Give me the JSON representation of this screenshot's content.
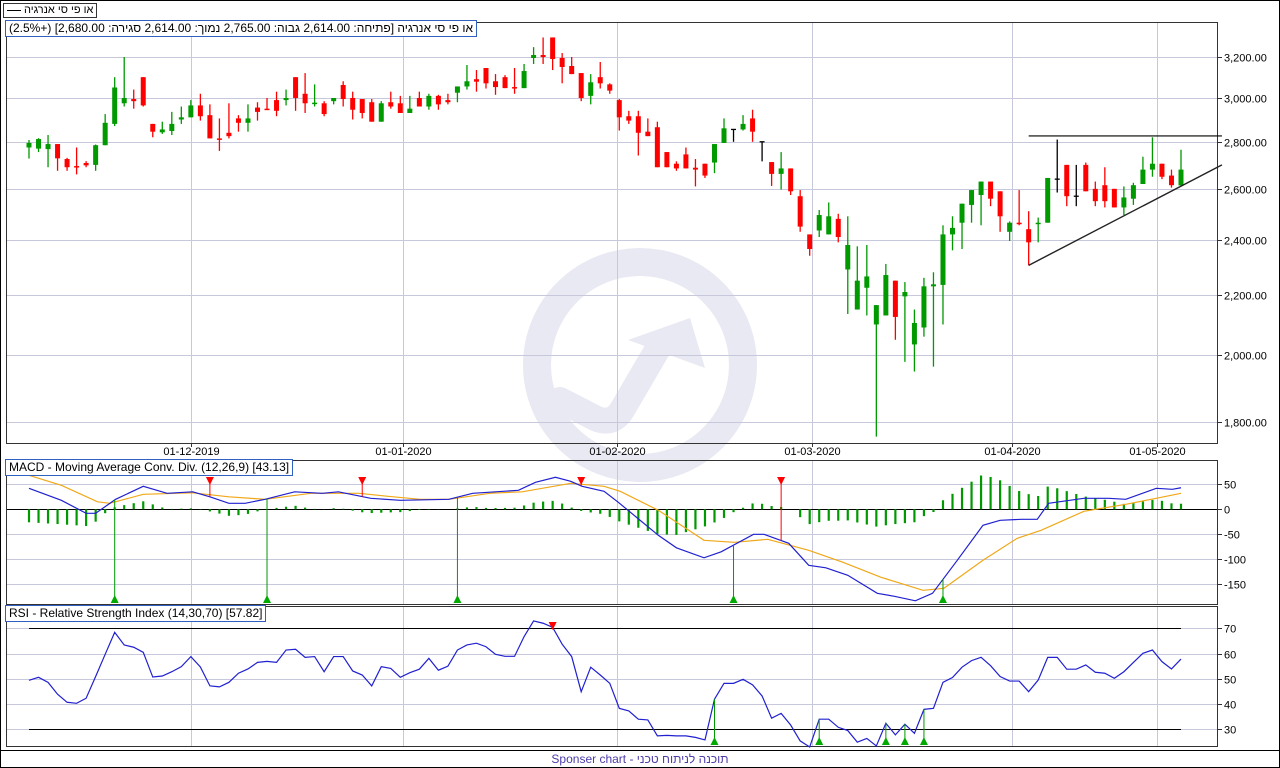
{
  "legend": {
    "symbol_name": "או פי סי אנרגיה"
  },
  "header": {
    "text": "או פי סי אנרגיה [פתיחה: 2,614.00  גבוה: 2,765.00  נמוך: 2,614.00  סגירה: 2,680.00] (+2.5%)"
  },
  "macd_title": "MACD - Moving Average Conv. Div. (12,26,9) [43.13]",
  "rsi_title": "RSI - Relative Strength Index (14,30,70) [57.82]",
  "footer": "Sponser chart - תוכנה לניתוח טכני",
  "colors": {
    "up": "#009900",
    "down": "#ff0000",
    "unchanged": "#000000",
    "macd": "#2020d0",
    "signal": "#f0a818",
    "grid": "#c8c8dc",
    "watermark": "#e9e9f3"
  },
  "chart_data": [
    {
      "type": "candlestick",
      "title": "או פי סי אנרגיה",
      "scale": "log",
      "ylim": [
        1760,
        3300
      ],
      "y_ticks": [
        "3,200.00",
        "3,000.00",
        "2,800.00",
        "2,600.00",
        "2,400.00",
        "2,200.00",
        "2,000.00",
        "1,800.00"
      ],
      "y_tick_values": [
        3200,
        3000,
        2800,
        2600,
        2400,
        2200,
        2000,
        1800
      ],
      "x_ticks": [
        {
          "label": "01-12-2019",
          "index": 17
        },
        {
          "label": "01-01-2020",
          "index": 39.3
        },
        {
          "label": "01-02-2020",
          "index": 61.8
        },
        {
          "label": "01-03-2020",
          "index": 82.2
        },
        {
          "label": "01-04-2020",
          "index": 103.3
        },
        {
          "label": "01-05-2020",
          "index": 118.5
        }
      ],
      "ohlc": [
        [
          2775,
          2808,
          2727,
          2795
        ],
        [
          2770,
          2816,
          2755,
          2812
        ],
        [
          2768,
          2830,
          2690,
          2790
        ],
        [
          2790,
          2790,
          2675,
          2728
        ],
        [
          2725,
          2730,
          2675,
          2690
        ],
        [
          2695,
          2775,
          2660,
          2690
        ],
        [
          2708,
          2716,
          2690,
          2698
        ],
        [
          2700,
          2788,
          2675,
          2785
        ],
        [
          2785,
          2925,
          2785,
          2885
        ],
        [
          2880,
          3100,
          2870,
          3050
        ],
        [
          2975,
          3200,
          2960,
          3000
        ],
        [
          2995,
          3040,
          2950,
          2985
        ],
        [
          3100,
          3100,
          2960,
          2965
        ],
        [
          2880,
          2880,
          2820,
          2845
        ],
        [
          2842,
          2890,
          2835,
          2855
        ],
        [
          2848,
          2935,
          2830,
          2880
        ],
        [
          2900,
          2960,
          2880,
          2910
        ],
        [
          2910,
          2990,
          2910,
          2965
        ],
        [
          2965,
          3020,
          2895,
          2915
        ],
        [
          2920,
          2970,
          2815,
          2815
        ],
        [
          2815,
          2905,
          2760,
          2810
        ],
        [
          2840,
          2975,
          2815,
          2825
        ],
        [
          2905,
          2920,
          2845,
          2885
        ],
        [
          2885,
          2970,
          2845,
          2905
        ],
        [
          2955,
          2980,
          2895,
          2935
        ],
        [
          2950,
          3000,
          2945,
          2945
        ],
        [
          2990,
          3030,
          2915,
          2940
        ],
        [
          2990,
          3040,
          2965,
          3000
        ],
        [
          3100,
          3100,
          2940,
          3000
        ],
        [
          3020,
          3120,
          2930,
          2975
        ],
        [
          2975,
          3065,
          2960,
          2978
        ],
        [
          2975,
          2985,
          2915,
          2925
        ],
        [
          2985,
          3000,
          2970,
          3000
        ],
        [
          3062,
          3080,
          2960,
          2995
        ],
        [
          3000,
          3030,
          2900,
          2945
        ],
        [
          2995,
          2995,
          2905,
          2930
        ],
        [
          2980,
          2995,
          2890,
          2890
        ],
        [
          2890,
          2985,
          2890,
          2975
        ],
        [
          2980,
          3030,
          2950,
          2960
        ],
        [
          2975,
          3010,
          2930,
          2930
        ],
        [
          2930,
          3010,
          2930,
          2950
        ],
        [
          3000,
          3030,
          2960,
          2960
        ],
        [
          2960,
          3020,
          2945,
          3010
        ],
        [
          3010,
          3015,
          2945,
          2970
        ],
        [
          2990,
          3020,
          2970,
          2980
        ],
        [
          3025,
          3055,
          2980,
          3055
        ],
        [
          3055,
          3160,
          3040,
          3080
        ],
        [
          3090,
          3135,
          3030,
          3078
        ],
        [
          3145,
          3145,
          3045,
          3070
        ],
        [
          3080,
          3115,
          3015,
          3052
        ],
        [
          3100,
          3110,
          3047,
          3047
        ],
        [
          3052,
          3145,
          3020,
          3047
        ],
        [
          3047,
          3165,
          3047,
          3130
        ],
        [
          3195,
          3250,
          3165,
          3210
        ],
        [
          3210,
          3300,
          3165,
          3200
        ],
        [
          3300,
          3300,
          3135,
          3190
        ],
        [
          3195,
          3220,
          3070,
          3150
        ],
        [
          3155,
          3200,
          3115,
          3115
        ],
        [
          3120,
          3120,
          2985,
          3000
        ],
        [
          3010,
          3115,
          2970,
          3075
        ],
        [
          3100,
          3175,
          3045,
          3070
        ],
        [
          3065,
          3070,
          3020,
          3035
        ],
        [
          2990,
          2995,
          2850,
          2910
        ],
        [
          2915,
          2940,
          2880,
          2895
        ],
        [
          2915,
          2940,
          2740,
          2840
        ],
        [
          2845,
          2905,
          2825,
          2825
        ],
        [
          2865,
          2890,
          2690,
          2690
        ],
        [
          2755,
          2755,
          2690,
          2690
        ],
        [
          2705,
          2715,
          2675,
          2685
        ],
        [
          2745,
          2775,
          2685,
          2685
        ],
        [
          2688,
          2725,
          2610,
          2680
        ],
        [
          2705,
          2705,
          2645,
          2655
        ],
        [
          2710,
          2790,
          2665,
          2790
        ],
        [
          2795,
          2905,
          2795,
          2860
        ],
        [
          2855,
          2855,
          2800,
          2855
        ],
        [
          2855,
          2920,
          2850,
          2880
        ],
        [
          2905,
          2945,
          2800,
          2845
        ],
        [
          2800,
          2800,
          2715,
          2800
        ],
        [
          2712,
          2712,
          2612,
          2662
        ],
        [
          2662,
          2755,
          2597,
          2685
        ],
        [
          2685,
          2685,
          2575,
          2590
        ],
        [
          2570,
          2595,
          2430,
          2450
        ],
        [
          2420,
          2420,
          2340,
          2365
        ],
        [
          2435,
          2515,
          2410,
          2495
        ],
        [
          2420,
          2545,
          2420,
          2490
        ],
        [
          2480,
          2500,
          2390,
          2410
        ],
        [
          2290,
          2490,
          2135,
          2380
        ],
        [
          2150,
          2375,
          2150,
          2250
        ],
        [
          2225,
          2380,
          2130,
          2265
        ],
        [
          2100,
          2165,
          1760,
          2165
        ],
        [
          2130,
          2310,
          2130,
          2270
        ],
        [
          2250,
          2250,
          2050,
          2125
        ],
        [
          2195,
          2245,
          1980,
          2210
        ],
        [
          2035,
          2150,
          1950,
          2105
        ],
        [
          2090,
          2260,
          2060,
          2230
        ],
        [
          2230,
          2280,
          1965,
          2237
        ],
        [
          2235,
          2455,
          2100,
          2420
        ],
        [
          2420,
          2490,
          2360,
          2445
        ],
        [
          2465,
          2540,
          2365,
          2540
        ],
        [
          2535,
          2595,
          2465,
          2595
        ],
        [
          2575,
          2630,
          2455,
          2630
        ],
        [
          2630,
          2630,
          2530,
          2560
        ],
        [
          2590,
          2590,
          2430,
          2490
        ],
        [
          2430,
          2470,
          2395,
          2465
        ],
        [
          2465,
          2595,
          2455,
          2460
        ],
        [
          2440,
          2510,
          2305,
          2390
        ],
        [
          2460,
          2485,
          2390,
          2465
        ],
        [
          2465,
          2645,
          2465,
          2645
        ],
        [
          2640,
          2810,
          2585,
          2640
        ],
        [
          2700,
          2700,
          2530,
          2570
        ],
        [
          2570,
          2700,
          2530,
          2570
        ],
        [
          2700,
          2710,
          2590,
          2590
        ],
        [
          2600,
          2630,
          2530,
          2550
        ],
        [
          2615,
          2690,
          2525,
          2550
        ],
        [
          2600,
          2600,
          2525,
          2525
        ],
        [
          2525,
          2610,
          2495,
          2565
        ],
        [
          2560,
          2625,
          2535,
          2615
        ],
        [
          2620,
          2735,
          2620,
          2680
        ],
        [
          2680,
          2820,
          2650,
          2705
        ],
        [
          2705,
          2705,
          2640,
          2650
        ],
        [
          2655,
          2680,
          2605,
          2615
        ],
        [
          2614,
          2765,
          2614,
          2680
        ]
      ],
      "drawings": [
        {
          "type": "horizontal-line",
          "from_index": 105,
          "to_index": 125.3,
          "price": 2826
        },
        {
          "type": "trendline",
          "from": [
            105,
            2305
          ],
          "to": [
            125.3,
            2700
          ]
        }
      ]
    },
    {
      "type": "line",
      "title": "MACD - Moving Average Conv. Div. (12,26,9)",
      "ylim": [
        -188,
        94
      ],
      "y_ticks": [
        50,
        0,
        -50,
        -100,
        -150
      ],
      "y_tick_labels": [
        "50",
        "0",
        "-50",
        "-100",
        "-150"
      ],
      "macd": [
        [
          0,
          42
        ],
        [
          3.4,
          18
        ],
        [
          6,
          -8
        ],
        [
          7,
          -8
        ],
        [
          9.1,
          20
        ],
        [
          12,
          46
        ],
        [
          14.5,
          32
        ],
        [
          17.2,
          35
        ],
        [
          19,
          25
        ],
        [
          21,
          12
        ],
        [
          22.7,
          12
        ],
        [
          24.8,
          20
        ],
        [
          27.9,
          35
        ],
        [
          30.8,
          32
        ],
        [
          32.5,
          35
        ],
        [
          35.9,
          22
        ],
        [
          39,
          18
        ],
        [
          44.1,
          20
        ],
        [
          46.6,
          32
        ],
        [
          51.4,
          38
        ],
        [
          53.2,
          54
        ],
        [
          55.3,
          64
        ],
        [
          56.9,
          56
        ],
        [
          58.1,
          46
        ],
        [
          60.4,
          36
        ],
        [
          61.9,
          14
        ],
        [
          66.1,
          -52
        ],
        [
          68,
          -77
        ],
        [
          70.9,
          -97
        ],
        [
          72.7,
          -85
        ],
        [
          76.1,
          -50
        ],
        [
          77.2,
          -50
        ],
        [
          79.8,
          -68
        ],
        [
          81.9,
          -112
        ],
        [
          83.7,
          -117
        ],
        [
          86,
          -132
        ],
        [
          89.1,
          -168
        ],
        [
          90.9,
          -174
        ],
        [
          93.1,
          -183
        ],
        [
          94.9,
          -168
        ],
        [
          97.5,
          -102
        ],
        [
          100.2,
          -32
        ],
        [
          102,
          -22
        ],
        [
          104.2,
          -20
        ],
        [
          105.9,
          -20
        ],
        [
          107.1,
          12
        ],
        [
          110.8,
          22
        ],
        [
          113.4,
          22
        ],
        [
          115.2,
          20
        ],
        [
          118.4,
          42
        ],
        [
          120.1,
          40
        ],
        [
          121,
          43.13
        ]
      ],
      "signal": [
        [
          0,
          68
        ],
        [
          3.4,
          48
        ],
        [
          7.2,
          15
        ],
        [
          8.5,
          12
        ],
        [
          12,
          30
        ],
        [
          17.2,
          33
        ],
        [
          21,
          25
        ],
        [
          24.8,
          20
        ],
        [
          29.6,
          32
        ],
        [
          34.7,
          32
        ],
        [
          37.7,
          26
        ],
        [
          41.1,
          20
        ],
        [
          44.1,
          20
        ],
        [
          48.4,
          32
        ],
        [
          51.8,
          35
        ],
        [
          56.9,
          52
        ],
        [
          60.4,
          46
        ],
        [
          62.1,
          36
        ],
        [
          66.1,
          -2
        ],
        [
          70.9,
          -62
        ],
        [
          74.1,
          -66
        ],
        [
          77.6,
          -60
        ],
        [
          81.9,
          -82
        ],
        [
          85.5,
          -106
        ],
        [
          89.5,
          -136
        ],
        [
          93.9,
          -162
        ],
        [
          96.1,
          -158
        ],
        [
          100.2,
          -102
        ],
        [
          103.8,
          -58
        ],
        [
          106.3,
          -42
        ],
        [
          110.8,
          -4
        ],
        [
          115.2,
          10
        ],
        [
          118.4,
          22
        ],
        [
          121,
          32
        ]
      ],
      "histogram": "macd-minus-signal",
      "sell_signals": [
        19,
        35,
        58,
        79
      ],
      "buy_signals": [
        9,
        25,
        45,
        74,
        96
      ],
      "last_value": 43.13
    },
    {
      "type": "line",
      "title": "RSI - Relative Strength Index (14,30,70)",
      "ylim": [
        22,
        78
      ],
      "levels": [
        30,
        70
      ],
      "y_ticks": [
        70,
        60,
        50,
        40,
        30
      ],
      "y_tick_labels": [
        "70",
        "60",
        "50",
        "40",
        "30"
      ],
      "rsi": [
        49.4,
        50.6,
        48.6,
        43.9,
        40.7,
        40.3,
        42.3,
        50.9,
        59.7,
        68.4,
        63.4,
        62.5,
        60.5,
        50.7,
        51.1,
        52.8,
        54.8,
        58.8,
        54.7,
        47.2,
        46.8,
        48.6,
        52.2,
        53.9,
        56.5,
        56.9,
        56.5,
        61.4,
        61.7,
        58.5,
        58.8,
        52.8,
        58.8,
        58.8,
        53.1,
        51.5,
        47.2,
        54.8,
        54.1,
        50.6,
        52.4,
        53.8,
        58.1,
        53.4,
        55,
        61.4,
        63.4,
        64.1,
        62.7,
        59.7,
        58.9,
        58.9,
        66.7,
        72.9,
        72,
        70.4,
        63.7,
        58.8,
        44.9,
        54.6,
        51.5,
        48.2,
        38.3,
        37.3,
        34,
        33.7,
        27.4,
        27.6,
        27.4,
        27.4,
        26.8,
        25.8,
        41.9,
        48.2,
        48.2,
        49.8,
        47.6,
        43.2,
        34.4,
        36.3,
        31.7,
        25.4,
        23,
        34,
        34,
        30.8,
        29.5,
        24.9,
        26.4,
        23.4,
        32.4,
        27.8,
        32,
        28.4,
        37.9,
        38.3,
        48.6,
        50.5,
        54.6,
        57.2,
        58.5,
        55.2,
        50.9,
        49.1,
        49.1,
        44.9,
        49.5,
        58.5,
        58.5,
        53.8,
        53.8,
        55.5,
        52.6,
        52.2,
        50.2,
        52.8,
        56.5,
        60.1,
        61.4,
        56.8,
        53.9,
        57.82
      ],
      "sell_signals": [
        55
      ],
      "buy_signals": [
        72,
        83,
        90,
        92,
        94
      ],
      "last_value": 57.82
    }
  ]
}
